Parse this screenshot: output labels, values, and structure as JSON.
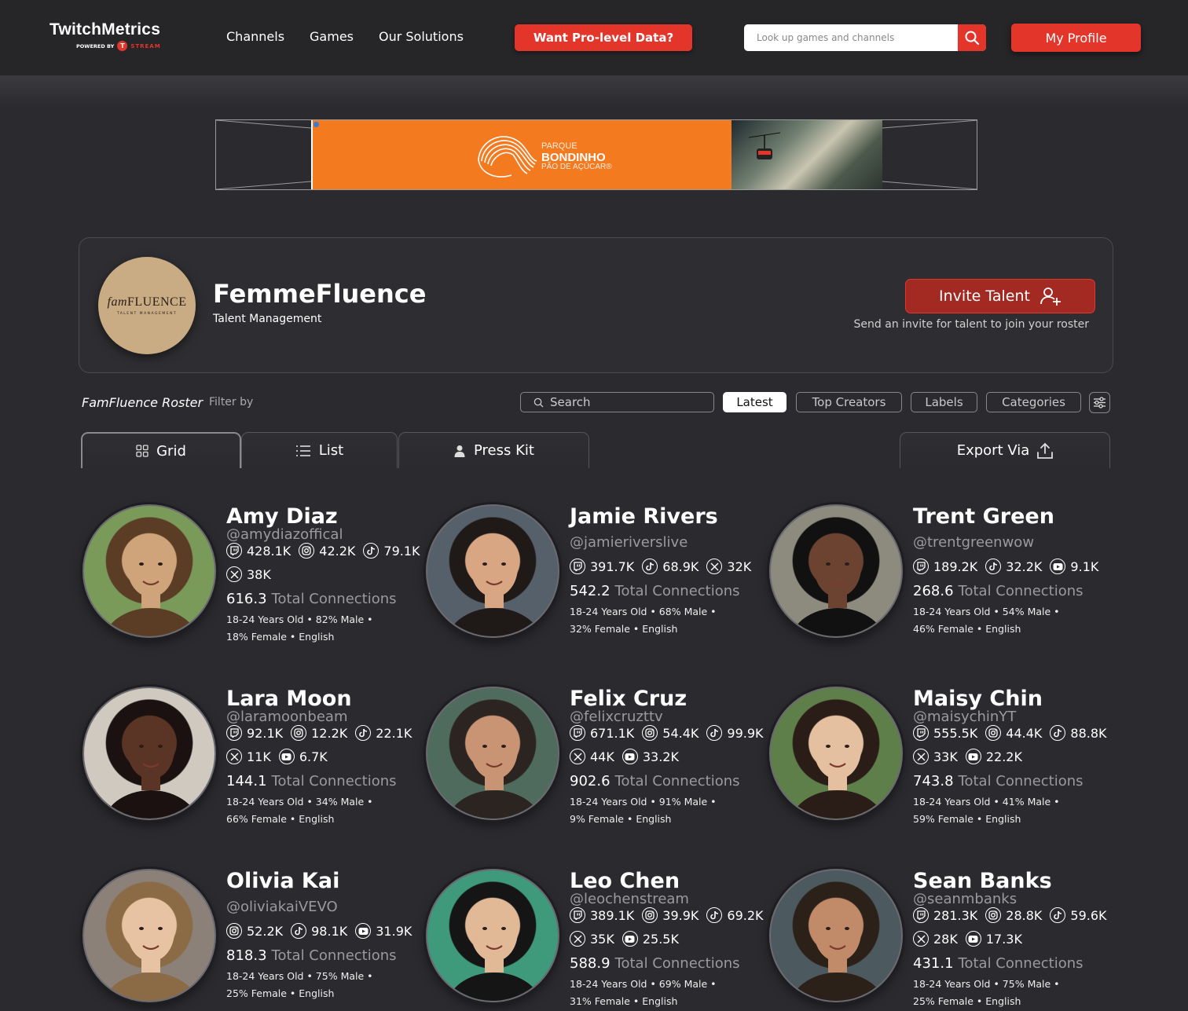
{
  "nav": {
    "logo": "TwitchMetrics",
    "logo_sub": "POWERED BY",
    "logo_brand": "STREAM",
    "links": [
      "Channels",
      "Games",
      "Our Solutions"
    ],
    "pro_label": "Want Pro-level Data?",
    "search_placeholder": "Look up games and channels",
    "profile_label": "My Profile",
    "accent": "#e4352a"
  },
  "ad": {
    "line1": "PARQUE",
    "line2": "BONDINHO",
    "line3": "PÃO DE AÇÚCAR®"
  },
  "agency": {
    "logo_script": "fam",
    "logo_main": "FLUENCE",
    "logo_sub": "TALENT MANAGEMENT",
    "name": "FemmeFluence",
    "type": "Talent Management",
    "invite_label": "Invite Talent",
    "invite_sub": "Send an invite for talent to join your roster"
  },
  "roster": {
    "title": "FamFluence Roster",
    "filter_label": "Filter by",
    "search_placeholder": "Search",
    "chips": [
      "Latest",
      "Top Creators",
      "Labels",
      "Categories"
    ],
    "tabs": [
      "Grid",
      "List",
      "Press Kit"
    ],
    "export_label": "Export Via"
  },
  "total_label": "Total Connections",
  "creators": [
    {
      "name": "Amy Diaz",
      "handle": "@amydiazoffical",
      "stats": [
        {
          "p": "twitch",
          "v": "428.1K"
        },
        {
          "p": "instagram",
          "v": "42.2K"
        },
        {
          "p": "tiktok",
          "v": "79.1K"
        },
        {
          "p": "x",
          "v": "38K"
        }
      ],
      "total": "616.3",
      "demo1": "18-24 Years Old  •  82% Male  •",
      "demo2": "18% Female  •  English"
    },
    {
      "name": "Jamie Rivers",
      "handle": "@jamieriverslive",
      "stats": [
        {
          "p": "twitch",
          "v": "391.7K"
        },
        {
          "p": "tiktok",
          "v": "68.9K"
        },
        {
          "p": "x",
          "v": "32K"
        }
      ],
      "total": "542.2",
      "demo1": "18-24 Years Old  •  68% Male  •",
      "demo2": "32% Female  •  English"
    },
    {
      "name": "Trent Green",
      "handle": "@trentgreenwow",
      "stats": [
        {
          "p": "twitch",
          "v": "189.2K"
        },
        {
          "p": "tiktok",
          "v": "32.2K"
        },
        {
          "p": "youtube",
          "v": "9.1K"
        }
      ],
      "total": "268.6",
      "demo1": "18-24 Years Old  •  54% Male  •",
      "demo2": "46% Female  •  English"
    },
    {
      "name": "Lara Moon",
      "handle": "@laramoonbeam",
      "stats": [
        {
          "p": "twitch",
          "v": "92.1K"
        },
        {
          "p": "instagram",
          "v": "12.2K"
        },
        {
          "p": "tiktok",
          "v": "22.1K"
        },
        {
          "p": "x",
          "v": "11K"
        },
        {
          "p": "youtube",
          "v": "6.7K"
        }
      ],
      "total": "144.1",
      "demo1": "18-24 Years Old  •  34% Male  •",
      "demo2": "66% Female  •  English"
    },
    {
      "name": "Felix Cruz",
      "handle": "@felixcruzttv",
      "stats": [
        {
          "p": "twitch",
          "v": "671.1K"
        },
        {
          "p": "instagram",
          "v": "54.4K"
        },
        {
          "p": "tiktok",
          "v": "99.9K"
        },
        {
          "p": "x",
          "v": "44K"
        },
        {
          "p": "youtube",
          "v": "33.2K"
        }
      ],
      "total": "902.6",
      "demo1": "18-24 Years Old  •  91% Male  •",
      "demo2": "9% Female  •  English"
    },
    {
      "name": "Maisy Chin",
      "handle": "@maisychinYT",
      "stats": [
        {
          "p": "twitch",
          "v": "555.5K"
        },
        {
          "p": "instagram",
          "v": "44.4K"
        },
        {
          "p": "tiktok",
          "v": "88.8K"
        },
        {
          "p": "x",
          "v": "33K"
        },
        {
          "p": "youtube",
          "v": "22.2K"
        }
      ],
      "total": "743.8",
      "demo1": "18-24 Years Old  •  41% Male  •",
      "demo2": "59% Female  •  English"
    },
    {
      "name": "Olivia Kai",
      "handle": "@oliviakaiVEVO",
      "stats": [
        {
          "p": "instagram",
          "v": "52.2K"
        },
        {
          "p": "tiktok",
          "v": "98.1K"
        },
        {
          "p": "youtube",
          "v": "31.9K"
        }
      ],
      "total": "818.3",
      "demo1": "18-24 Years Old  •  75% Male  •",
      "demo2": "25% Female  •  English"
    },
    {
      "name": "Leo Chen",
      "handle": "@leochenstream",
      "stats": [
        {
          "p": "twitch",
          "v": "389.1K"
        },
        {
          "p": "instagram",
          "v": "39.9K"
        },
        {
          "p": "tiktok",
          "v": "69.2K"
        },
        {
          "p": "x",
          "v": "35K"
        },
        {
          "p": "youtube",
          "v": "25.5K"
        }
      ],
      "total": "588.9",
      "demo1": "18-24 Years Old  •  69% Male  •",
      "demo2": "31% Female  •  English"
    },
    {
      "name": "Sean Banks",
      "handle": "@seanmbanks",
      "stats": [
        {
          "p": "twitch",
          "v": "281.3K"
        },
        {
          "p": "instagram",
          "v": "28.8K"
        },
        {
          "p": "tiktok",
          "v": "59.6K"
        },
        {
          "p": "x",
          "v": "28K"
        },
        {
          "p": "youtube",
          "v": "17.3K"
        }
      ],
      "total": "431.1",
      "demo1": "18-24 Years Old  •  75% Male  •",
      "demo2": "25% Female  •  English"
    }
  ]
}
